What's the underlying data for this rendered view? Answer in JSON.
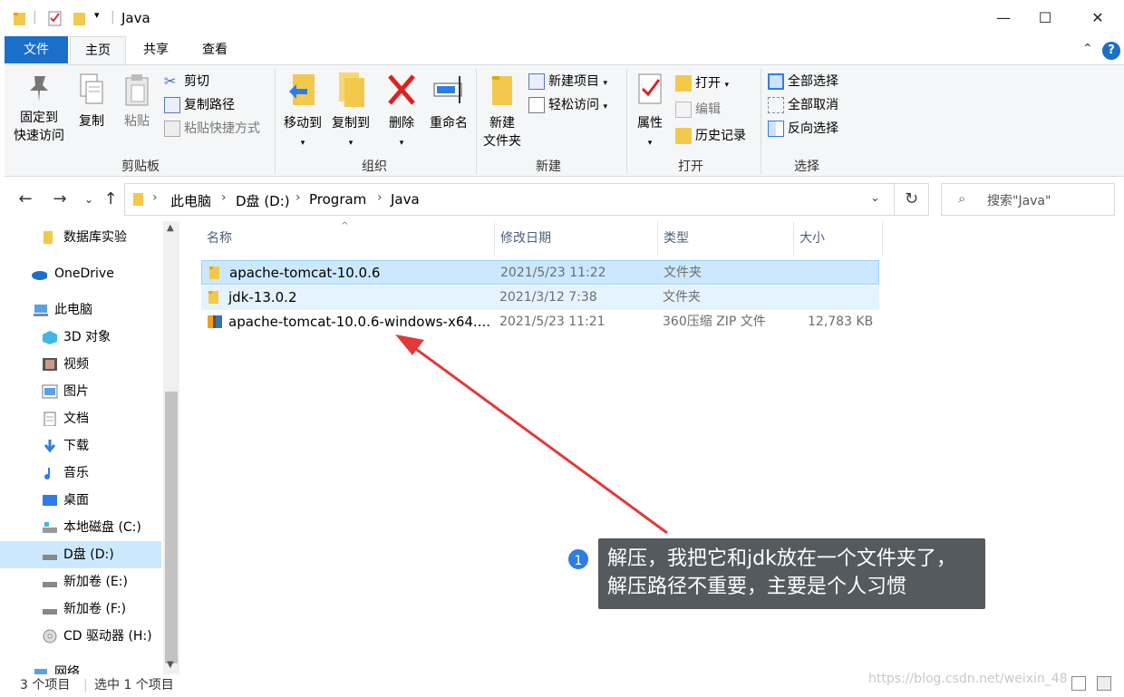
{
  "window": {
    "title": "Java"
  },
  "titlebar": {
    "minimize": "—",
    "maximize": "☐",
    "close": "✕"
  },
  "ribbon_tabs": {
    "file": "文件",
    "home": "主页",
    "share": "共享",
    "view": "查看"
  },
  "ribbon": {
    "clipboard": {
      "pin": "固定到\n快速访问",
      "pin_l1": "固定到",
      "pin_l2": "快速访问",
      "copy": "复制",
      "paste": "粘贴",
      "cut": "剪切",
      "copy_path": "复制路径",
      "paste_shortcut": "粘贴快捷方式",
      "label": "剪贴板"
    },
    "organize": {
      "move_to": "移动到",
      "copy_to": "复制到",
      "delete": "删除",
      "rename": "重命名",
      "label": "组织"
    },
    "new": {
      "new_folder_l1": "新建",
      "new_folder_l2": "文件夹",
      "new_item": "新建项目",
      "easy_access": "轻松访问",
      "label": "新建"
    },
    "open": {
      "properties": "属性",
      "open": "打开",
      "edit": "编辑",
      "history": "历史记录",
      "label": "打开"
    },
    "select": {
      "select_all": "全部选择",
      "select_none": "全部取消",
      "invert": "反向选择",
      "label": "选择"
    }
  },
  "address": {
    "crumbs": [
      "此电脑",
      "D盘 (D:)",
      "Program",
      "Java"
    ],
    "search_placeholder": "搜索\"Java\""
  },
  "nav": {
    "items": [
      {
        "label": "数据库实验",
        "icon": "folder-icon"
      },
      {
        "label": "OneDrive",
        "icon": "onedrive-icon"
      },
      {
        "label": "此电脑",
        "icon": "computer-icon"
      },
      {
        "label": "3D 对象",
        "icon": "3d-objects-icon"
      },
      {
        "label": "视频",
        "icon": "video-icon"
      },
      {
        "label": "图片",
        "icon": "pictures-icon"
      },
      {
        "label": "文档",
        "icon": "documents-icon"
      },
      {
        "label": "下载",
        "icon": "downloads-icon"
      },
      {
        "label": "音乐",
        "icon": "music-icon"
      },
      {
        "label": "桌面",
        "icon": "desktop-icon"
      },
      {
        "label": "本地磁盘 (C:)",
        "icon": "drive-c-icon"
      },
      {
        "label": "D盘 (D:)",
        "icon": "drive-icon"
      },
      {
        "label": "新加卷 (E:)",
        "icon": "drive-icon"
      },
      {
        "label": "新加卷 (F:)",
        "icon": "drive-icon"
      },
      {
        "label": "CD 驱动器 (H:)",
        "icon": "cd-drive-icon"
      },
      {
        "label": "网络",
        "icon": "network-icon"
      }
    ]
  },
  "columns": {
    "name": "名称",
    "modified": "修改日期",
    "type": "类型",
    "size": "大小"
  },
  "files": [
    {
      "name": "apache-tomcat-10.0.6",
      "modified": "2021/5/23 11:22",
      "type": "文件夹",
      "size": "",
      "icon": "folder-icon"
    },
    {
      "name": "jdk-13.0.2",
      "modified": "2021/3/12 7:38",
      "type": "文件夹",
      "size": "",
      "icon": "folder-icon"
    },
    {
      "name": "apache-tomcat-10.0.6-windows-x64....",
      "modified": "2021/5/23 11:21",
      "type": "360压缩 ZIP 文件",
      "size": "12,783 KB",
      "icon": "zip-archive-icon"
    }
  ],
  "status": {
    "count": "3 个项目",
    "selected": "选中 1 个项目"
  },
  "annotation": {
    "badge": "1",
    "line1": "解压，我把它和jdk放在一个文件夹了，",
    "line2": "解压路径不重要，主要是个人习惯"
  },
  "watermark": "https://blog.csdn.net/weixin_48",
  "colors": {
    "file_tab": "#1a6fc9",
    "selection": "#cce8ff",
    "arrow": "#e23a3a",
    "callout": "#555a5e",
    "badge": "#2e7de6"
  }
}
